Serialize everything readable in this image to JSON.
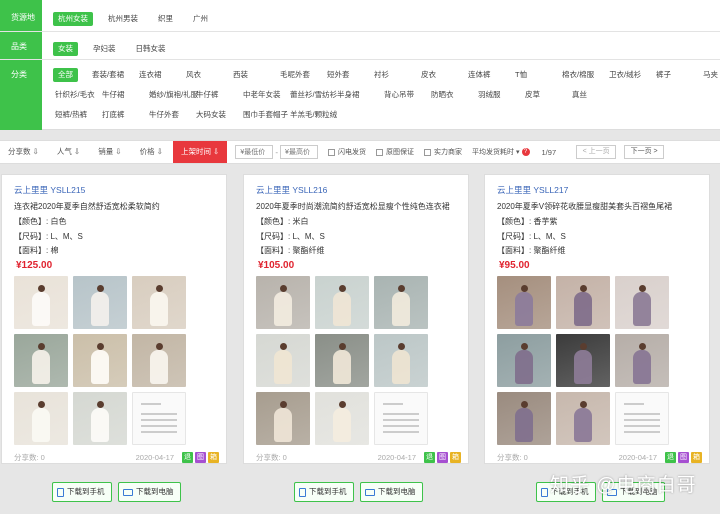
{
  "filters": {
    "source": {
      "label": "货源地",
      "options": [
        {
          "text": "杭州女装",
          "selected": true
        },
        {
          "text": "杭州男装",
          "selected": false
        },
        {
          "text": "织里",
          "selected": false
        },
        {
          "text": "广州",
          "selected": false
        }
      ]
    },
    "category": {
      "label": "品类",
      "options": [
        {
          "text": "女装",
          "selected": true
        },
        {
          "text": "孕妇装",
          "selected": false
        },
        {
          "text": "日韩女装",
          "selected": false
        }
      ]
    },
    "subcategory": {
      "label": "分类",
      "rows": [
        [
          "全部",
          "套装/套裙",
          "连衣裙",
          "风衣",
          "西装",
          "毛呢外套",
          "短外套",
          "衬衫",
          "皮衣",
          "连体裤",
          "T恤",
          "棉衣/棉服",
          "卫衣/绒衫",
          "裤子",
          "马夹"
        ],
        [
          "针织衫/毛衣",
          "牛仔裙",
          "婚纱/旗袍/礼服",
          "牛仔裤",
          "中老年女装",
          "蕾丝衫/雪纺衫",
          "半身裙",
          "背心吊带",
          "防晒衣",
          "羽绒服",
          "皮草",
          "真丝"
        ],
        [
          "短裤/热裤",
          "打底裤",
          "牛仔外套",
          "大码女装",
          "围巾手套帽子",
          "羊羔毛/颗粒绒"
        ]
      ]
    }
  },
  "sortbar": {
    "buttons": [
      "分享数 ⇩",
      "人气 ⇩",
      "销量 ⇩",
      "价格 ⇩",
      "上架时间 ⇩"
    ],
    "active_index": 4,
    "price_min_placeholder": "¥最低价",
    "price_max_placeholder": "¥最高价",
    "dash": "-",
    "checks": [
      "闪电发货",
      "原图保证",
      "实力商家"
    ],
    "avg_ship": "平均发货耗时 ▾",
    "qmark": "?",
    "page": "1/97",
    "prev": "< 上一页",
    "next": "下一页 >"
  },
  "products": [
    {
      "shop": "云上里里 YSLL215",
      "title": "连衣裙2020年夏季自然舒适宽松柔软简约",
      "color": "【颜色】: 白色",
      "size": "【尺码】: L、M、S",
      "fabric": "【面料】: 棉",
      "price": "¥125.00",
      "shares": "分享数: 0",
      "date": "2020-04-17",
      "tags": [
        "退",
        "图",
        "箱"
      ]
    },
    {
      "shop": "云上里里 YSLL216",
      "title": "2020年夏季时尚潮流简约舒适宽松显瘦个性纯色连衣裙",
      "color": "【颜色】: 米白",
      "size": "【尺码】: L、M、S",
      "fabric": "【面料】: 聚酯纤维",
      "price": "¥105.00",
      "shares": "分享数: 0",
      "date": "2020-04-17",
      "tags": [
        "退",
        "图",
        "箱"
      ]
    },
    {
      "shop": "云上里里 YSLL217",
      "title": "2020年夏季V领碎花收腰显瘦甜美套头百褶鱼尾裙",
      "color": "【颜色】: 香芋紫",
      "size": "【尺码】: L、M、S",
      "fabric": "【面料】: 聚酯纤维",
      "price": "¥95.00",
      "shares": "分享数: 0",
      "date": "2020-04-17",
      "tags": [
        "退",
        "图",
        "箱"
      ]
    }
  ],
  "download": {
    "phone": "下载到手机",
    "pc": "下载到电脑"
  },
  "watermark": "知乎 @电商白哥",
  "colors": {
    "accent_green": "#3ec24a",
    "active_red": "#e8383d",
    "price_red": "#e0232f",
    "shop_blue": "#3b66b8"
  }
}
